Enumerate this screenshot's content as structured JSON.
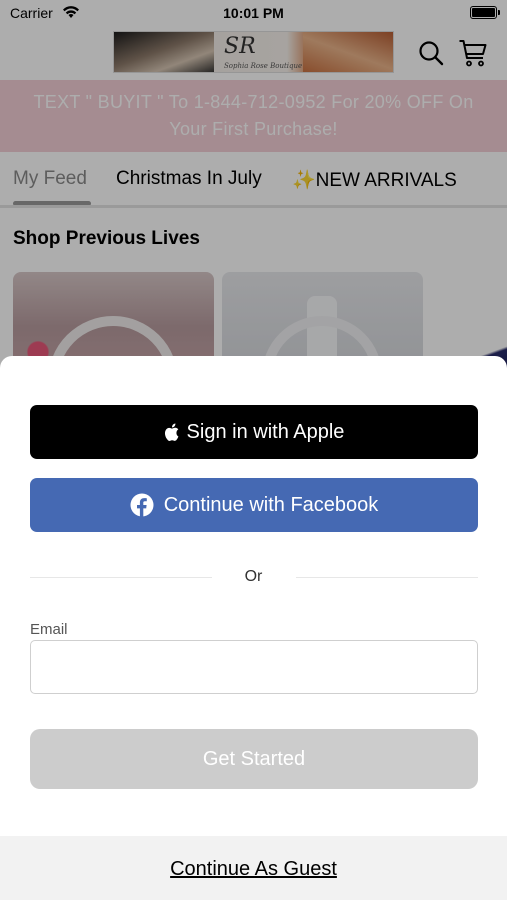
{
  "status_bar": {
    "carrier": "Carrier",
    "time": "10:01 PM",
    "wifi_icon": "wifi-icon",
    "battery_icon": "battery-icon"
  },
  "header": {
    "logo_monogram": "SR",
    "logo_script": "Sophia Rose Boutique",
    "search_icon": "search-icon",
    "cart_icon": "cart-icon"
  },
  "promo": {
    "line1": "TEXT \" BUYIT \" To 1-844-712-0952 For 20% OFF On",
    "line2": "Your First Purchase!"
  },
  "tabs": [
    {
      "label": "My Feed",
      "active": true
    },
    {
      "label": "Christmas In July",
      "active": false
    },
    {
      "label": "✨NEW ARRIVALS",
      "active": false
    }
  ],
  "feed": {
    "section_title": "Shop Previous Lives"
  },
  "auth_sheet": {
    "apple_button": "Sign in with Apple",
    "facebook_button": "Continue with Facebook",
    "divider_text": "Or",
    "email_label": "Email",
    "email_value": "",
    "email_placeholder": "",
    "get_started_button": "Get Started",
    "guest_link": "Continue As Guest"
  },
  "colors": {
    "promo_bg": "#f4cfd6",
    "facebook_blue": "#4569b3",
    "apple_black": "#000000",
    "disabled_button": "#cccccc",
    "guest_bar_bg": "#f2f2f2"
  }
}
